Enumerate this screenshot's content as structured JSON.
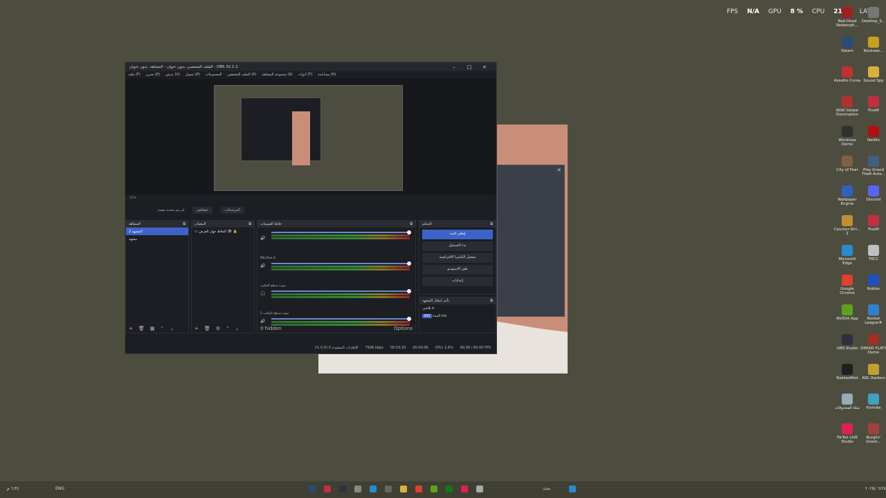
{
  "hud": {
    "fps_label": "FPS",
    "fps_value": "N/A",
    "gpu_label": "GPU",
    "gpu_value": "8 %",
    "cpu_label": "CPU",
    "cpu_value": "21 %",
    "lat_label": "LAT"
  },
  "desktop": [
    {
      "label": "Red Dead Redempti...",
      "color": "#a02020"
    },
    {
      "label": "Desktop_S...",
      "color": "#777"
    },
    {
      "label": "Steam",
      "color": "#2a4a7a"
    },
    {
      "label": "Rockstar...",
      "color": "#c8a020"
    },
    {
      "label": "Assetto Corsa",
      "color": "#c03030"
    },
    {
      "label": "Sound Spy",
      "color": "#d8b040"
    },
    {
      "label": "RISK Global Domination",
      "color": "#b03030"
    },
    {
      "label": "FiveM",
      "color": "#c03040"
    },
    {
      "label": "Windrose Demo",
      "color": "#303030"
    },
    {
      "label": "Netflix",
      "color": "#b01010"
    },
    {
      "label": "City of Fear",
      "color": "#806040"
    },
    {
      "label": "Play Grand Theft Auto...",
      "color": "#406080"
    },
    {
      "label": "Wallpaper Engine",
      "color": "#3060c0"
    },
    {
      "label": "Discord",
      "color": "#5865f2"
    },
    {
      "label": "Counter-Stri... 2",
      "color": "#c09030"
    },
    {
      "label": "FiveM",
      "color": "#c03040"
    },
    {
      "label": "Microsoft Edge",
      "color": "#2a8ad0"
    },
    {
      "label": "TRCC",
      "color": "#c0c0c0"
    },
    {
      "label": "Google Chrome",
      "color": "#e04030"
    },
    {
      "label": "Roblox",
      "color": "#2050c0"
    },
    {
      "label": "NVIDIA App",
      "color": "#60a020"
    },
    {
      "label": "Rocket League®",
      "color": "#3080d0"
    },
    {
      "label": "OBS Studio",
      "color": "#303040"
    },
    {
      "label": "DREAD FLATS Demo",
      "color": "#a03020"
    },
    {
      "label": "BakkesMod",
      "color": "#202020"
    },
    {
      "label": "ARC Raiders",
      "color": "#c0a030"
    },
    {
      "label": "سلة المحذوفات",
      "color": "#9ab"
    },
    {
      "label": "Fortnite",
      "color": "#40a0c0"
    },
    {
      "label": "TikTok LIVE Studio",
      "color": "#e02050"
    },
    {
      "label": "Burglin' Gnom...",
      "color": "#a04040"
    }
  ],
  "obs": {
    "title": "الملف الشخصي: بدون عنوان - المشاهد: بدون عنوان - OBS 32.1.1",
    "menu": [
      "ملف (F)",
      "تحرير (E)",
      "عرض (V)",
      "تحويل (P)",
      "المجموعات",
      "الملف الشخصي (P)",
      "مجموعة المشاهد (S)",
      "أدوات (T)",
      "مساعدة (H)"
    ],
    "preview_zoom": "31%",
    "controls": [
      "لم يتم تحديد مصدر",
      "خصائص",
      "المرشحات"
    ],
    "docks": {
      "scenes": "المشاهد",
      "sources": "المصادر",
      "mixer": "خلاط الصوتيات",
      "controls": "التحكم",
      "transitions": "تأثير انتقال المشهد"
    },
    "scenes": [
      "المشهد 2",
      "مشهد"
    ],
    "sources": [
      "التقاط جهاز العرض"
    ],
    "mixer": [
      {
        "name": "",
        "level": "0.0 dB",
        "badge": "Global"
      },
      {
        "name": "Mic/Aux 4",
        "level": "0.0 dB",
        "badge": "Global"
      },
      {
        "name": "صوت سطح المكتب",
        "level": "0.0 dB",
        "badge": "Global"
      },
      {
        "name": "صوت سطح المكتب 2",
        "level": "0.0 dB",
        "badge": "Global"
      }
    ],
    "mixer_footer": {
      "hidden": "0 hidden",
      "options": "Options"
    },
    "control_buttons": [
      "إيقاف البث",
      "بدء التسجيل",
      "تشغيل الكاميرا الافتراضية",
      "طور الاستوديو",
      "إعدادات"
    ],
    "transition": {
      "type": "تلاشي",
      "duration_label": "المدة",
      "duration_value": "300",
      "unit": "ms"
    },
    "status": {
      "dropped": "الإطارات المفقودة 0 (0.0 %)",
      "bitrate": "7936 kbps",
      "rec_time": "00:03:19",
      "stream_time": "00:00:00",
      "cpu": "CPU: 1.6%",
      "fps": "60.00 / 60.00 FPS"
    }
  },
  "taskbar": {
    "lang": "ENG",
    "time": "٦:٣٤ م",
    "date": "٢٠٢٥/٠٦/٢٥",
    "search": "بحث"
  }
}
